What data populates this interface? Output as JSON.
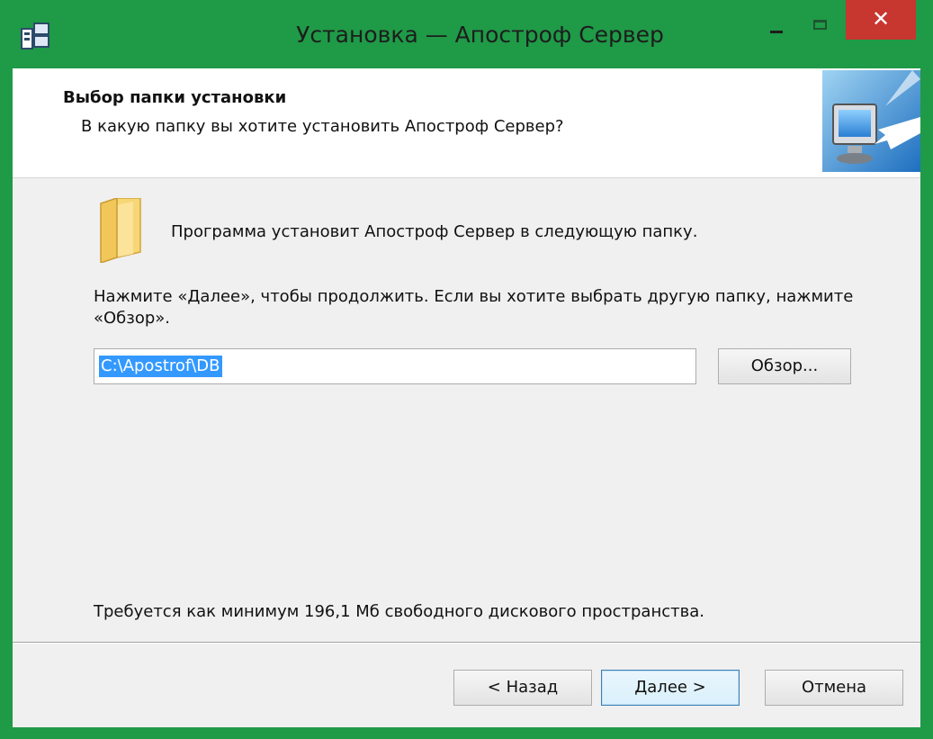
{
  "window": {
    "title": "Установка — Апостроф Сервер",
    "close_symbol": "✕",
    "colors": {
      "frame": "#1f9a47",
      "close": "#c7372f",
      "selection": "#3399ff"
    }
  },
  "header": {
    "title": "Выбор папки установки",
    "subtitle": "В какую папку вы хотите установить Апостроф Сервер?",
    "image_icon": "monitor-install-icon"
  },
  "body": {
    "folder_icon": "folder-icon",
    "info_line": "Программа установит Апостроф Сервер в следующую папку.",
    "instruction": "Нажмите «Далее», чтобы продолжить. Если вы хотите выбрать другую папку, нажмите «Обзор».",
    "path_value": "C:\\Apostrof\\DB",
    "browse_label": "Обзор...",
    "space_required": "Требуется как минимум 196,1 Мб свободного дискового пространства."
  },
  "footer": {
    "back_label": "< Назад",
    "next_label": "Далее >",
    "cancel_label": "Отмена"
  }
}
